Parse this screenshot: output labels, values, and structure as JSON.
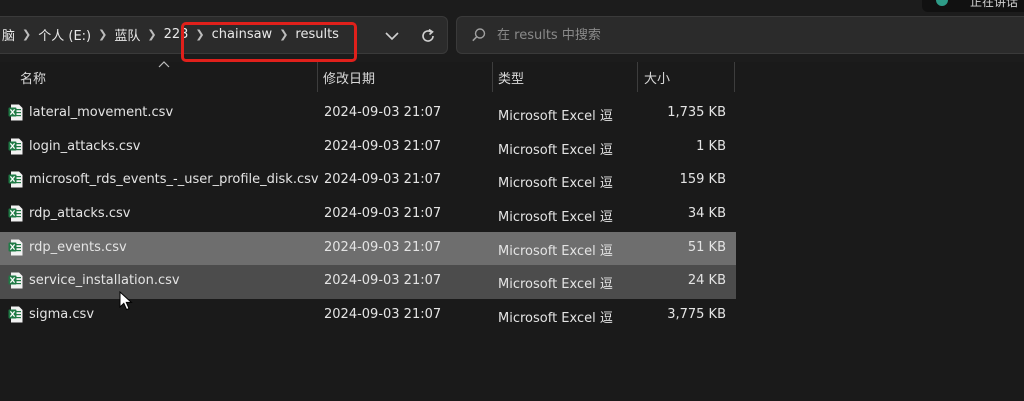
{
  "address": {
    "crumbs": [
      "脑",
      "个人 (E:)",
      "蓝队",
      "223",
      "chainsaw",
      "results"
    ]
  },
  "search": {
    "placeholder": "在 results 中搜索"
  },
  "overlay": {
    "speaking_text": "正在讲话"
  },
  "columns": {
    "name": "名称",
    "date": "修改日期",
    "type": "类型",
    "size": "大小"
  },
  "files": [
    {
      "name": "lateral_movement.csv",
      "date": "2024-09-03 21:07",
      "type": "Microsoft Excel 逗",
      "size": "1,735 KB"
    },
    {
      "name": "login_attacks.csv",
      "date": "2024-09-03 21:07",
      "type": "Microsoft Excel 逗",
      "size": "1 KB"
    },
    {
      "name": "microsoft_rds_events_-_user_profile_disk.csv",
      "date": "2024-09-03 21:07",
      "type": "Microsoft Excel 逗",
      "size": "159 KB"
    },
    {
      "name": "rdp_attacks.csv",
      "date": "2024-09-03 21:07",
      "type": "Microsoft Excel 逗",
      "size": "34 KB"
    },
    {
      "name": "rdp_events.csv",
      "date": "2024-09-03 21:07",
      "type": "Microsoft Excel 逗",
      "size": "51 KB",
      "state": "selected"
    },
    {
      "name": "service_installation.csv",
      "date": "2024-09-03 21:07",
      "type": "Microsoft Excel 逗",
      "size": "24 KB",
      "state": "hover"
    },
    {
      "name": "sigma.csv",
      "date": "2024-09-03 21:07",
      "type": "Microsoft Excel 逗",
      "size": "3,775 KB"
    }
  ],
  "colors": {
    "highlight_box": "#e0201b",
    "excel_green": "#1f7a45",
    "selected_row": "#6e6e6e",
    "hover_row": "#4c4c4c"
  }
}
